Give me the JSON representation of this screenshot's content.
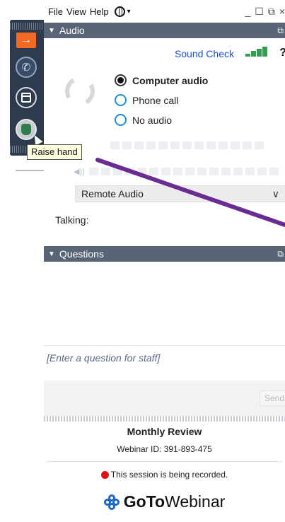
{
  "menu": {
    "file": "File",
    "view": "View",
    "help": "Help",
    "language_icon": "globe-icon",
    "caret": "▾"
  },
  "window_controls": {
    "minimize": "_",
    "maximize": "☐",
    "popout": "⧉",
    "close": "×"
  },
  "toolbar_tab": {
    "items": [
      {
        "icon": "arrow-right-icon",
        "glyph": "→"
      },
      {
        "icon": "phone-icon",
        "glyph": "✆"
      },
      {
        "icon": "window-icon"
      },
      {
        "icon": "raise-hand-icon"
      }
    ],
    "tooltip": "Raise hand"
  },
  "audio": {
    "header": "Audio",
    "collapse_glyph": "▼",
    "popout_glyph": "⧉",
    "sound_check": "Sound Check",
    "help_glyph": "?",
    "options": [
      {
        "label": "Computer audio",
        "selected": true
      },
      {
        "label": "Phone call",
        "selected": false
      },
      {
        "label": "No audio",
        "selected": false
      }
    ],
    "speaker_glyph": "◀))",
    "dropdown_value": "Remote Audio",
    "dropdown_chevron": "∨",
    "talking_label": "Talking:"
  },
  "questions": {
    "header": "Questions",
    "collapse_glyph": "▼",
    "popout_glyph": "⧉",
    "placeholder": "[Enter a question for staff]",
    "send_label": "Send"
  },
  "footer": {
    "title": "Monthly Review",
    "webinar_id": "Webinar ID: 391-893-475",
    "recording_notice": "This session is being recorded.",
    "logo_bold": "GoTo",
    "logo_light": "Webinar"
  },
  "colors": {
    "header_bg": "#5a6477",
    "accent_orange": "#f26a22",
    "link_blue": "#1a4fd9",
    "signal_green": "#2aa24a",
    "annotation_purple": "#6a2c91",
    "record_red": "#e01414"
  }
}
